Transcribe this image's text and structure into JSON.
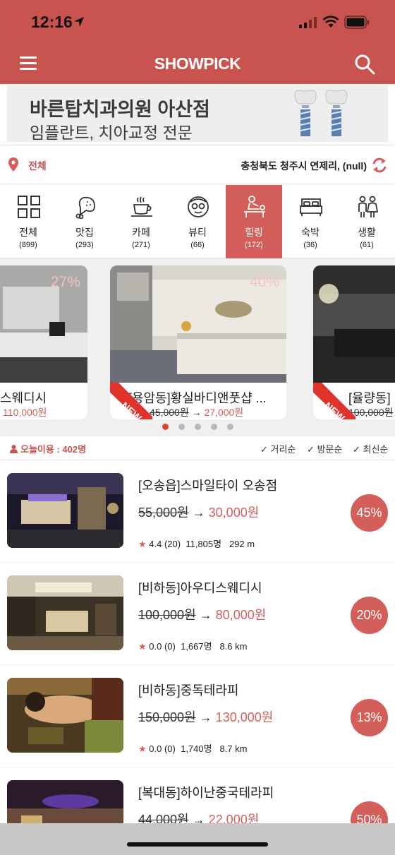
{
  "status_bar": {
    "time": "12:16"
  },
  "header": {
    "brand": "SHOWPICK"
  },
  "banner": {
    "title": "바른탑치과의원 아산점",
    "subtitle": "임플란트, 치아교정 전문"
  },
  "location": {
    "all_label": "전체",
    "address": "충청북도 청주시 연제리, (null)"
  },
  "categories": [
    {
      "label": "전체",
      "count": "(899)",
      "icon": "grid-icon"
    },
    {
      "label": "맛집",
      "count": "(293)",
      "icon": "chicken-leg-icon"
    },
    {
      "label": "카페",
      "count": "(271)",
      "icon": "coffee-cup-icon"
    },
    {
      "label": "뷰티",
      "count": "(66)",
      "icon": "face-mask-icon"
    },
    {
      "label": "힐링",
      "count": "(172)",
      "icon": "massage-icon",
      "active": true
    },
    {
      "label": "숙박",
      "count": "(36)",
      "icon": "bed-icon"
    },
    {
      "label": "생활",
      "count": "(61)",
      "icon": "family-icon"
    }
  ],
  "carousel": {
    "cards": [
      {
        "discount": "27%",
        "name": "스웨디시",
        "original_price": "",
        "price": "110,000원"
      },
      {
        "discount": "40%",
        "name": "[용암동]황실바디앤풋샵 ...",
        "original_price": "45,000원",
        "price": "27,000원",
        "badge": "NEW"
      },
      {
        "discount": "",
        "name": "[율량동]",
        "original_price": "100,000원",
        "price": "",
        "badge": "NEW"
      }
    ],
    "arrow": "→",
    "page_count": 5,
    "active_page": 1
  },
  "sort": {
    "today_label": "오늘이용 : 402명",
    "options": [
      "✓ 거리순",
      "✓ 방문순",
      "✓ 최신순"
    ]
  },
  "list": [
    {
      "name": "[오송읍]스마일타이 오송점",
      "original_price": "55,000원",
      "price": "30,000원",
      "rating": "4.4 (20)",
      "visits": "11,805명",
      "distance": "292 m",
      "discount": "45%"
    },
    {
      "name": "[비하동]아우디스웨디시",
      "original_price": "100,000원",
      "price": "80,000원",
      "rating": "0.0 (0)",
      "visits": "1,667명",
      "distance": "8.6 km",
      "discount": "20%"
    },
    {
      "name": "[비하동]중독테라피",
      "original_price": "150,000원",
      "price": "130,000원",
      "rating": "0.0 (0)",
      "visits": "1,740명",
      "distance": "8.7 km",
      "discount": "13%"
    },
    {
      "name": "[복대동]하이난중국테라피",
      "original_price": "44,000원",
      "price": "22,000원",
      "rating": "",
      "visits": "",
      "distance": "",
      "discount": "50%"
    }
  ],
  "colors": {
    "brand": "#c9534f",
    "accent": "#d45e5a",
    "dot_active": "#d9442f"
  }
}
